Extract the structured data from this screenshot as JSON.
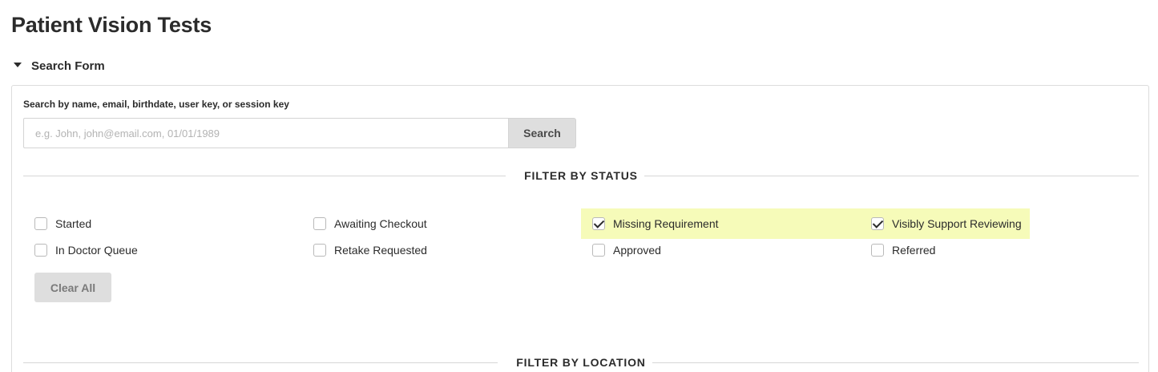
{
  "page": {
    "title": "Patient Vision Tests"
  },
  "search_form": {
    "toggle_label": "Search Form",
    "search_label": "Search by name, email, birthdate, user key, or session key",
    "search_placeholder": "e.g. John, john@email.com, 01/01/1989",
    "search_value": "",
    "search_button": "Search"
  },
  "filter_status": {
    "title": "FILTER BY STATUS",
    "items": [
      {
        "label": "Started",
        "checked": false
      },
      {
        "label": "Awaiting Checkout",
        "checked": false
      },
      {
        "label": "Missing Requirement",
        "checked": true
      },
      {
        "label": "Visibly Support Reviewing",
        "checked": true
      },
      {
        "label": "In Doctor Queue",
        "checked": false
      },
      {
        "label": "Retake Requested",
        "checked": false
      },
      {
        "label": "Approved",
        "checked": false
      },
      {
        "label": "Referred",
        "checked": false
      }
    ],
    "clear_button": "Clear All"
  },
  "filter_location": {
    "title": "FILTER BY LOCATION"
  },
  "colors": {
    "highlight": "#f6fbb9",
    "button_bg": "#dedede",
    "text": "#2b2b2b"
  }
}
